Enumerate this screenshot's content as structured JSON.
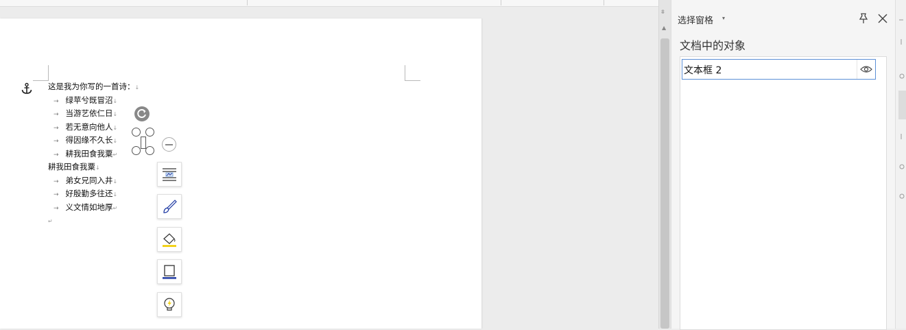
{
  "document": {
    "poem": [
      {
        "text": "这是我为你写的一首诗：",
        "indent": false,
        "end": "↓"
      },
      {
        "text": "绿苹兮既冒沼",
        "indent": true,
        "end": "↓"
      },
      {
        "text": "当游艺依仁日",
        "indent": true,
        "end": "↓"
      },
      {
        "text": "若无意向他人",
        "indent": true,
        "end": "↓"
      },
      {
        "text": "得因缘不久长",
        "indent": true,
        "end": "↓"
      },
      {
        "text": "耕我田食我粟",
        "indent": true,
        "end": "↵"
      },
      {
        "text": "耕我田食我粟",
        "indent": false,
        "end": "↓"
      },
      {
        "text": "弟女兄同入井",
        "indent": true,
        "end": "↓"
      },
      {
        "text": "好殷勤多往还",
        "indent": true,
        "end": "↓"
      },
      {
        "text": "义文情如地厚",
        "indent": true,
        "end": "↵"
      },
      {
        "text": "",
        "indent": false,
        "end": "↵"
      }
    ],
    "tab_mark": "→"
  },
  "float_toolbar": {
    "buttons": [
      "wrap-text-icon",
      "brush-icon",
      "fill-color-icon",
      "border-color-icon",
      "smart-tool-icon"
    ]
  },
  "selection_pane": {
    "title": "选择窗格",
    "caret": "▾",
    "section": "文档中的对象",
    "objects": [
      {
        "name": "文本框 2",
        "visible": true
      }
    ]
  },
  "colors": {
    "accent": "#5b8fd6",
    "highlight_yellow": "#f2d21b",
    "border_blue": "#1f3aa3",
    "pane_bg": "#f5f5f5"
  }
}
